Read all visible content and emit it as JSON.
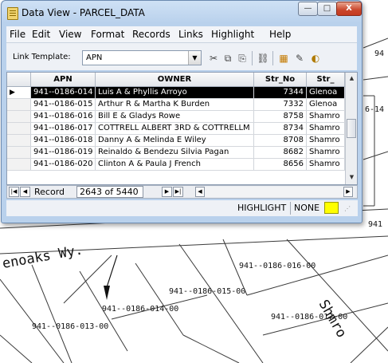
{
  "window": {
    "title": "Data View - PARCEL_DATA",
    "controls": {
      "minimize": "—",
      "maximize": "□",
      "close": "X"
    }
  },
  "menu": [
    "File",
    "Edit",
    "View",
    "Format",
    "Records",
    "Links",
    "Highlight",
    "Help"
  ],
  "toolbar": {
    "link_template_label": "Link Template:",
    "link_template_value": "APN",
    "icons": [
      "scissors-icon",
      "copy-icon",
      "paste-icon",
      "link-icon",
      "chart-icon",
      "tool-icon",
      "paint-icon"
    ]
  },
  "table": {
    "columns": [
      "APN",
      "OWNER",
      "Str_No",
      "Str_"
    ],
    "rows": [
      {
        "apn": "941--0186-014",
        "owner": "Luis A & Phyllis Arroyo",
        "str_no": "7344",
        "street": "Glenoa",
        "selected": true
      },
      {
        "apn": "941--0186-015",
        "owner": "Arthur R & Martha K Burden",
        "str_no": "7332",
        "street": "Glenoa"
      },
      {
        "apn": "941--0186-016",
        "owner": "Bill E & Gladys Rowe",
        "str_no": "8758",
        "street": "Shamro"
      },
      {
        "apn": "941--0186-017",
        "owner": "COTTRELL ALBERT 3RD & COTTRELLM",
        "str_no": "8734",
        "street": "Shamro"
      },
      {
        "apn": "941--0186-018",
        "owner": "Danny A & Melinda E Wiley",
        "str_no": "8708",
        "street": "Shamro"
      },
      {
        "apn": "941--0186-019",
        "owner": "Reinaldo & Bendezu Silvia Pagan",
        "str_no": "8682",
        "street": "Shamro"
      },
      {
        "apn": "941--0186-020",
        "owner": "Clinton A & Paula J French",
        "str_no": "8656",
        "street": "Shamro"
      }
    ]
  },
  "navigation": {
    "label": "Record",
    "position": "2643 of 5440"
  },
  "status": {
    "highlight_label": "HIGHLIGHT",
    "highlight_value": "NONE",
    "highlight_color": "#ffff00"
  },
  "map": {
    "labels": {
      "street_glenoaks": "enoaks Wy.",
      "street_shamrock": "Shmro",
      "parcel_013": "941--0186-013-00",
      "parcel_014": "941--0186-014-00",
      "parcel_015": "941--0186-015-00",
      "parcel_016": "941--0186-016-00",
      "parcel_017": "941--0186-017-00",
      "edge_top": "94",
      "edge_mid": "6-14",
      "edge_lower": "941"
    }
  }
}
